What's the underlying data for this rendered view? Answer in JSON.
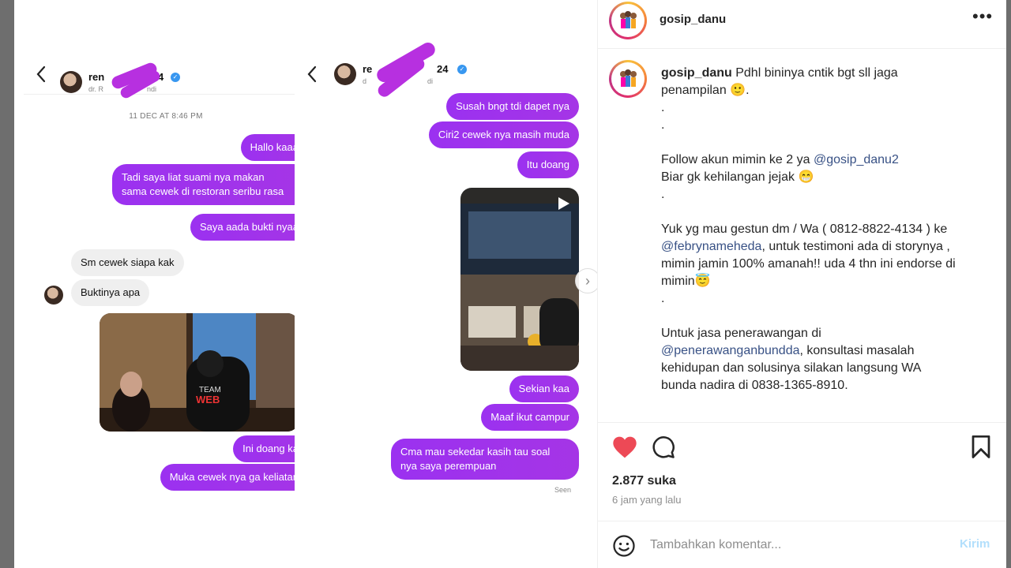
{
  "conversation_1": {
    "header_name": "ren",
    "header_name_tail": "4",
    "header_sub": "dr. R",
    "header_sub_tail": "ndi",
    "timestamp": "11 DEC AT 8:46 PM",
    "messages": [
      {
        "text": "Hallo kaaa",
        "side": "out"
      },
      {
        "text": "Tadi saya liat suami nya makan\nsama cewek di restoran seribu rasa",
        "side": "out"
      },
      {
        "text": "Saya aada bukti nyaa",
        "side": "out"
      },
      {
        "text": "Sm cewek siapa kak",
        "side": "in"
      },
      {
        "text": "Buktinya apa",
        "side": "in"
      },
      {
        "text": "Ini doang ka",
        "side": "out"
      },
      {
        "text": "Muka cewek nya ga keliatan",
        "side": "out"
      }
    ]
  },
  "conversation_2": {
    "header_name": "re",
    "header_name_tail": "24",
    "header_sub": "d",
    "header_sub_tail": "di",
    "messages": [
      {
        "text": "Susah bngt tdi dapet nya",
        "side": "out"
      },
      {
        "text": "Ciri2 cewek nya masih muda",
        "side": "out"
      },
      {
        "text": "Itu doang",
        "side": "out"
      },
      {
        "text": "Sekian kaa",
        "side": "out"
      },
      {
        "text": "Maaf ikut campur",
        "side": "out"
      },
      {
        "text": "Cma mau sekedar kasih tau soal\nnya saya perempuan",
        "side": "out"
      }
    ],
    "seen": "Seen"
  },
  "post": {
    "username": "gosip_danu",
    "caption_lines": [
      {
        "plain": "Pdhl bininya cntik bgt sll jaga"
      },
      {
        "plain": "penampilan 🙂."
      },
      {
        "plain": "."
      },
      {
        "plain": "."
      },
      {
        "plain": ""
      },
      {
        "pre": "Follow akun mimin ke 2 ya ",
        "mention": "@gosip_danu2",
        "post": ""
      },
      {
        "plain": "Biar gk kehilangan jejak 😁"
      },
      {
        "plain": "."
      },
      {
        "plain": ""
      },
      {
        "plain": "Yuk yg mau gestun dm / Wa ( 0812-8822-4134 ) ke"
      },
      {
        "pre": "",
        "mention": "@febrynameheda",
        "post": ", untuk testimoni ada di storynya ,"
      },
      {
        "plain": "mimin jamin 100% amanah!! uda 4 thn ini endorse di"
      },
      {
        "plain": "mimin😇"
      },
      {
        "plain": "."
      },
      {
        "plain": ""
      },
      {
        "plain": "Untuk jasa penerawangan di"
      },
      {
        "pre": "",
        "mention": "@penerawanganbundda",
        "post": ", konsultasi masalah"
      },
      {
        "plain": "kehidupan dan solusinya silakan langsung WA"
      },
      {
        "plain": "bunda nadira di 0838-1365-8910."
      }
    ],
    "likes": "2.877 suka",
    "time_ago": "6 jam yang lalu",
    "comment_placeholder": "Tambahkan komentar...",
    "send_label": "Kirim",
    "icons": {
      "like": "heart-filled-icon",
      "comment": "comment-bubble-icon",
      "save": "bookmark-icon",
      "more": "more-horizontal-icon",
      "emoji": "emoji-smile-icon"
    },
    "colors": {
      "like": "#ed4956",
      "mention": "#385185",
      "send": "#b2dffc",
      "bubble": "#9b31f0"
    }
  }
}
